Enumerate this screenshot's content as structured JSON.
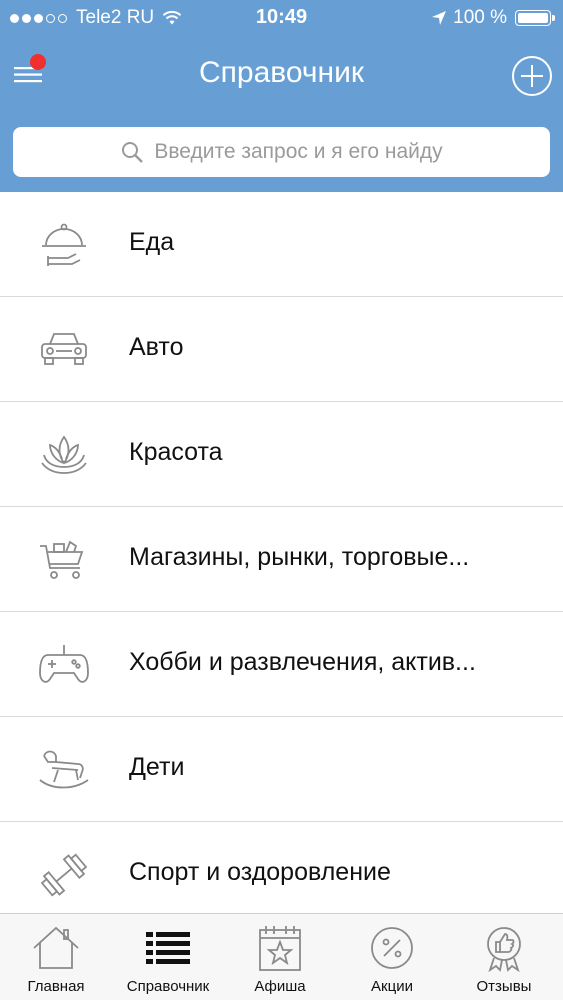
{
  "status_bar": {
    "carrier": "Tele2 RU",
    "time": "10:49",
    "battery": "100 %"
  },
  "nav": {
    "title": "Справочник",
    "menu_icon": "hamburger-menu-icon",
    "add_icon": "plus-circle-icon"
  },
  "search": {
    "placeholder": "Введите запрос и я его найду"
  },
  "categories": [
    {
      "label": "Еда",
      "icon": "food-cloche-icon"
    },
    {
      "label": "Авто",
      "icon": "car-icon"
    },
    {
      "label": "Красота",
      "icon": "lotus-icon"
    },
    {
      "label": "Магазины, рынки, торговые...",
      "icon": "shopping-cart-icon"
    },
    {
      "label": "Хобби и развлечения, актив...",
      "icon": "gamepad-icon"
    },
    {
      "label": "Дети",
      "icon": "rocking-horse-icon"
    },
    {
      "label": "Спорт и оздоровление",
      "icon": "dumbbell-icon"
    }
  ],
  "tabs": [
    {
      "label": "Главная",
      "icon": "home-icon"
    },
    {
      "label": "Справочник",
      "icon": "list-icon",
      "active": true
    },
    {
      "label": "Афиша",
      "icon": "calendar-star-icon"
    },
    {
      "label": "Акции",
      "icon": "percent-badge-icon"
    },
    {
      "label": "Отзывы",
      "icon": "thumbs-up-badge-icon"
    }
  ],
  "colors": {
    "header": "#679fd4",
    "badge": "#f0302f",
    "icon_gray": "#8a8a8a"
  }
}
